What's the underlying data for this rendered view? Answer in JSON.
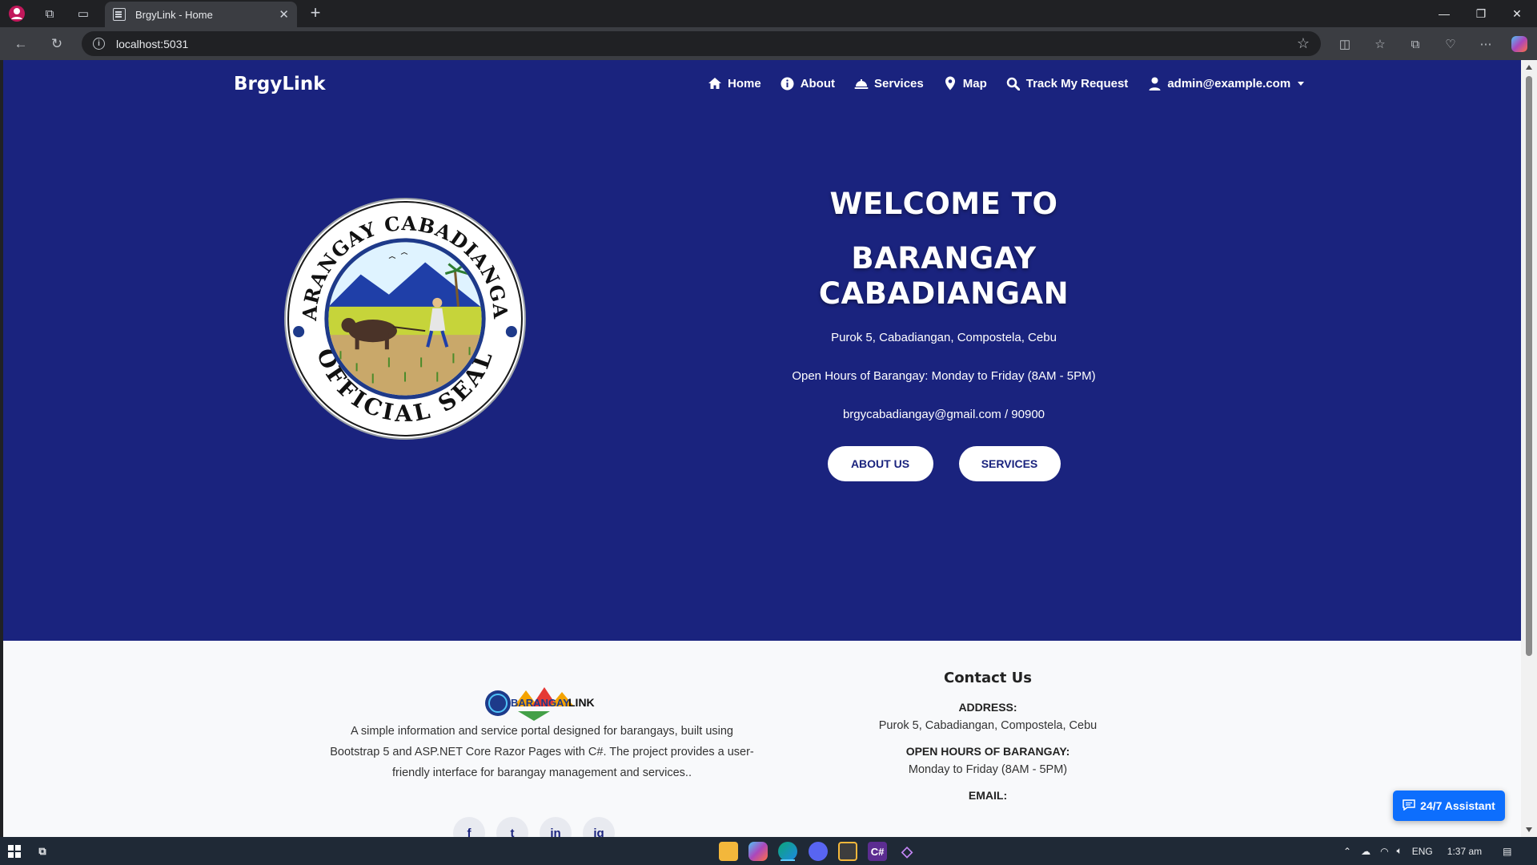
{
  "browser": {
    "tab_title": "BrgyLink - Home",
    "tab_close": "✕",
    "new_tab": "+",
    "url": "localhost:5031",
    "window": {
      "minimize": "—",
      "restore": "❐",
      "close": "✕"
    }
  },
  "site": {
    "brand": "BrgyLink",
    "nav": [
      {
        "label": "Home",
        "icon": "home-icon"
      },
      {
        "label": "About",
        "icon": "info-icon"
      },
      {
        "label": "Services",
        "icon": "bell-icon"
      },
      {
        "label": "Map",
        "icon": "map-pin-icon"
      },
      {
        "label": "Track My Request",
        "icon": "search-icon"
      },
      {
        "label": "admin@example.com",
        "icon": "user-icon"
      }
    ],
    "seal_text_top": "BARANGAY CABADIANGAN",
    "seal_text_bottom": "OFFICIAL SEAL"
  },
  "hero": {
    "line1": "WELCOME TO",
    "line2": "BARANGAY CABADIANGAN",
    "address": "Purok 5, Cabadiangan, Compostela, Cebu",
    "hours": "Open Hours of Barangay: Monday to Friday (8AM - 5PM)",
    "contact": "brgycabadiangay@gmail.com / 90900",
    "btn_about": "ABOUT US",
    "btn_services": "SERVICES"
  },
  "footer": {
    "logo_text_a": "BARANGAY",
    "logo_text_b": "LINK",
    "description": "A simple information and service portal designed for barangays, built using Bootstrap 5 and ASP.NET Core Razor Pages with C#. The project provides a user-friendly interface for barangay management and services..",
    "social": [
      "f",
      "t",
      "in",
      "ig"
    ],
    "contact_title": "Contact Us",
    "address_label": "ADDRESS:",
    "address_value": "Purok 5, Cabadiangan, Compostela, Cebu",
    "hours_label": "OPEN HOURS OF BARANGAY:",
    "hours_value": "Monday to Friday (8AM - 5PM)",
    "email_label": "EMAIL:"
  },
  "assistant_label": "24/7 Assistant",
  "taskbar": {
    "language": "ENG",
    "time": "1:37 am"
  },
  "colors": {
    "primary": "#1a237e",
    "assistant": "#0d6efd"
  }
}
